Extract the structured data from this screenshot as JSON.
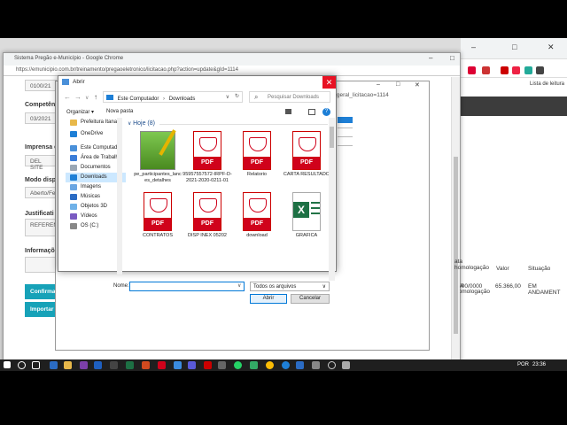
{
  "popup": {
    "title": "Sistema Pregão e-Município - Google Chrome",
    "url": "https://emunicipio.com.br/treinamento/pregaoeletronico/licitacao.php?action=update&gId=1114",
    "fields": [
      {
        "label": "",
        "value": "0100/21"
      },
      {
        "label": "Competên",
        "value": "03/2021"
      },
      {
        "label": "Imprensa o",
        "value": "DEL SITE"
      },
      {
        "label": "Modo disp",
        "value": "Aberto/Fe"
      },
      {
        "label": "Justificati",
        "value": "REFEREN"
      },
      {
        "label": "Informaçõ",
        "value": ""
      }
    ],
    "buttons": {
      "confirm": "Confirmas",
      "import": "Importar F"
    },
    "table": {
      "headers": [
        "ata homologação",
        "Valor",
        "Situação"
      ],
      "row": [
        "/00/0000",
        "65.366,00",
        "EM ANDAMENT"
      ]
    }
  },
  "browser": {
    "bookmark_label": "Lista de leitura"
  },
  "win2": {
    "url_fragment": "_d_geral_licitacao=1114"
  },
  "dialog": {
    "title": "Abrir",
    "close_label": "✕",
    "path": [
      "Este Computador",
      "Downloads"
    ],
    "search_placeholder": "Pesquisar Downloads",
    "organize": "Organizar ▾",
    "new_folder": "Nova pasta",
    "nav_items": [
      {
        "label": "Prefeitura Itanagr",
        "icon": "folder-icon",
        "color": "#e8b84a"
      },
      {
        "label": "OneDrive",
        "icon": "cloud-icon",
        "color": "#1e7fd6"
      },
      {
        "label": "Este Computador",
        "icon": "computer-icon",
        "color": "#4a90d9"
      },
      {
        "label": "Área de Trabalho",
        "icon": "desktop-icon",
        "color": "#3b7dd8"
      },
      {
        "label": "Documentos",
        "icon": "documents-icon",
        "color": "#9aa7b5"
      },
      {
        "label": "Downloads",
        "icon": "downloads-icon",
        "color": "#1e7fd6"
      },
      {
        "label": "Imagens",
        "icon": "images-icon",
        "color": "#6aa6e3"
      },
      {
        "label": "Músicas",
        "icon": "music-icon",
        "color": "#2b6cc4"
      },
      {
        "label": "Objetos 3D",
        "icon": "3d-objects-icon",
        "color": "#6fb1e8"
      },
      {
        "label": "Vídeos",
        "icon": "videos-icon",
        "color": "#7a5bc2"
      },
      {
        "label": "OS (C:)",
        "icon": "drive-icon",
        "color": "#888888"
      }
    ],
    "group": "Hoje (8)",
    "files": [
      {
        "name": "pe_participantes_lances_detalhes",
        "type": "img"
      },
      {
        "name": "95957557572-IRPF-D-2021-2020-0211-01",
        "type": "pdf"
      },
      {
        "name": "Relatorio",
        "type": "pdf"
      },
      {
        "name": "CARTA RESULTADO",
        "type": "pdf"
      },
      {
        "name": "CONTRATOS",
        "type": "pdf"
      },
      {
        "name": "DISP INEX 05202",
        "type": "pdf"
      },
      {
        "name": "download",
        "type": "pdf"
      },
      {
        "name": "GRAFICA",
        "type": "xls"
      }
    ],
    "name_label": "Nome:",
    "name_value": "",
    "filter": "Todos os arquivos",
    "open": "Abrir",
    "cancel": "Cancelar"
  },
  "taskbar": {
    "lang": "POR",
    "time": "23:36"
  },
  "colors": {
    "accent": "#17a2b8",
    "close": "#e81123",
    "pdf": "#d0021b",
    "excel": "#1d7044"
  }
}
